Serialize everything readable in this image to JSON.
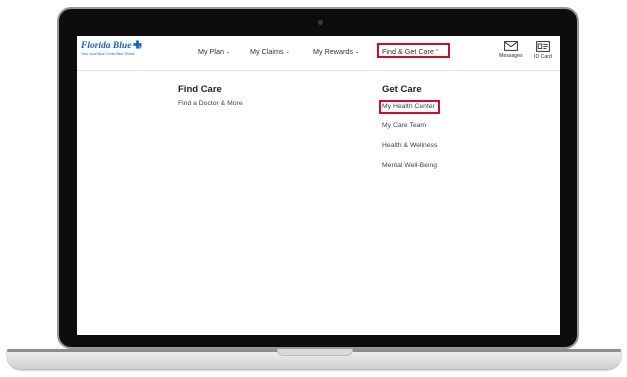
{
  "brand": {
    "name": "Florida Blue",
    "tagline": "Your local Blue Cross Blue Shield",
    "color": "#1565b0",
    "mark_icon": "cross-shield-logo-icon"
  },
  "nav": {
    "items": [
      {
        "label": "My Plan",
        "icon": "chevron-down-icon"
      },
      {
        "label": "My Claims",
        "icon": "chevron-down-icon"
      },
      {
        "label": "My Rewards",
        "icon": "chevron-down-icon"
      },
      {
        "label": "Find & Get Care",
        "icon": "chevron-up-icon",
        "active": true
      }
    ],
    "utility": [
      {
        "label": "Messages",
        "icon": "envelope-icon"
      },
      {
        "label": "ID Card",
        "icon": "id-card-icon"
      }
    ],
    "highlight_color": "#c8102e"
  },
  "menu": {
    "find_care": {
      "heading": "Find Care",
      "links": [
        "Find a Doctor & More"
      ]
    },
    "get_care": {
      "heading": "Get Care",
      "links": [
        "My Health Center",
        "My Care Team",
        "Health & Wellness",
        "Mental Well-Being"
      ]
    }
  }
}
